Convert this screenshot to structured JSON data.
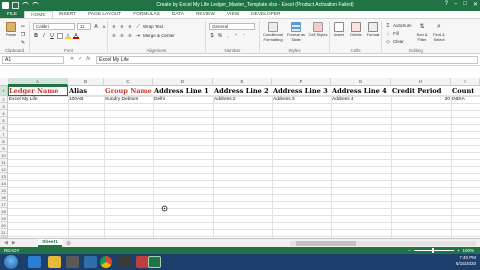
{
  "window": {
    "title": "Create by Excel My Life Ledger_Master_Template.xlsx - Excel (Product Activation Failed)",
    "controls": [
      "?",
      "–",
      "□",
      "✕"
    ]
  },
  "ribbon_tabs": [
    "FILE",
    "HOME",
    "INSERT",
    "PAGE LAYOUT",
    "FORMULAS",
    "DATA",
    "REVIEW",
    "VIEW",
    "DEVELOPER"
  ],
  "ribbon": {
    "clipboard": {
      "label": "Clipboard",
      "paste": "Paste"
    },
    "font": {
      "label": "Font",
      "name": "Calibri",
      "size": "11"
    },
    "alignment": {
      "label": "Alignment",
      "wrap": "Wrap Text",
      "merge": "Merge & Center"
    },
    "number": {
      "label": "Number",
      "format": "General"
    },
    "styles": {
      "label": "Styles",
      "conditional": "Conditional Formatting",
      "format_table": "Format as Table",
      "cell_styles": "Cell Styles"
    },
    "cells": {
      "label": "Cells",
      "insert": "Insert",
      "delete": "Delete",
      "format": "Format"
    },
    "editing": {
      "label": "Editing",
      "autosum": "AutoSum",
      "fill": "Fill",
      "clear": "Clear",
      "sort": "Sort & Filter",
      "find": "Find & Select"
    }
  },
  "formula_bar": {
    "name_box": "A1",
    "fx_icons": [
      "✕",
      "✓",
      "fx"
    ],
    "content": "Excel My Life"
  },
  "columns": [
    "A",
    "B",
    "C",
    "D",
    "E",
    "F",
    "G",
    "H",
    "I"
  ],
  "rows": [
    "1",
    "2",
    "3",
    "4",
    "5",
    "6",
    "7",
    "8",
    "9",
    "10",
    "11",
    "12",
    "13",
    "14",
    "15",
    "16",
    "17",
    "18",
    "19",
    "20",
    "21",
    "22"
  ],
  "sheet": {
    "headers": [
      "Ledger Name",
      "Alias",
      "Group Name",
      "Address Line 1",
      "Address Line 2",
      "Address Line 3",
      "Address Line 4",
      "Credit Period",
      "Count"
    ],
    "row2": [
      "Excel My Life",
      "100AB",
      "Sundry Debtors",
      "Delhi",
      "Address 2",
      "Address 3",
      "Address 4",
      "30",
      "INDIA"
    ],
    "colors": {
      "red_header": "#c0392b",
      "selection": "#217346"
    }
  },
  "sheet_tabs": {
    "active": "Sheet1",
    "add": "⊕"
  },
  "status": {
    "ready": "READY",
    "zoom": "100%"
  },
  "clock": {
    "time": "7:40 PM",
    "date": "5/15/2020"
  }
}
